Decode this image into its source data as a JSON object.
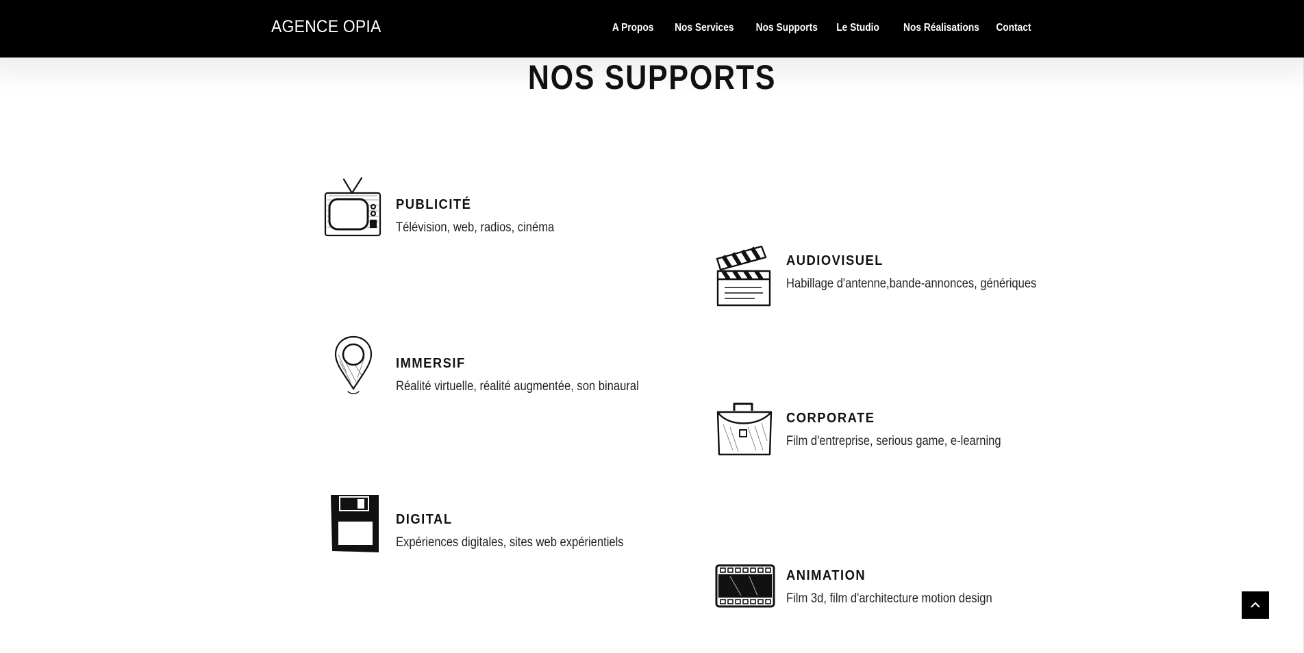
{
  "header": {
    "brand": "AGENCE OPIA",
    "nav": [
      {
        "label": "A Propos"
      },
      {
        "label": "Nos Services"
      },
      {
        "label": "Nos Supports"
      },
      {
        "label": "Le Studio"
      },
      {
        "label": "Nos Réalisations"
      },
      {
        "label": "Contact"
      }
    ]
  },
  "main": {
    "title": "NOS SUPPORTS",
    "items": [
      {
        "icon": "tv-icon",
        "title": "PUBLICITÉ",
        "desc": "Télévision, web, radios, cinéma"
      },
      {
        "icon": "clapperboard-icon",
        "title": "AUDIOVISUEL",
        "desc": "Habillage d'antenne,bande-annonces, génériques"
      },
      {
        "icon": "map-pin-icon",
        "title": "IMMERSIF",
        "desc": "Réalité virtuelle, réalité augmentée, son binaural"
      },
      {
        "icon": "briefcase-icon",
        "title": "CORPORATE",
        "desc": "Film d'entreprise, serious game, e-learning"
      },
      {
        "icon": "floppy-disk-icon",
        "title": "DIGITAL",
        "desc": "Expériences digitales, sites web expérientiels"
      },
      {
        "icon": "film-strip-icon",
        "title": "ANIMATION",
        "desc": "Film 3d, film d'architecture motion design"
      }
    ]
  },
  "back_to_top": {
    "icon": "chevron-up-icon"
  },
  "colors": {
    "header_bg": "#000000",
    "text": "#111111",
    "page_bg": "#ffffff"
  }
}
